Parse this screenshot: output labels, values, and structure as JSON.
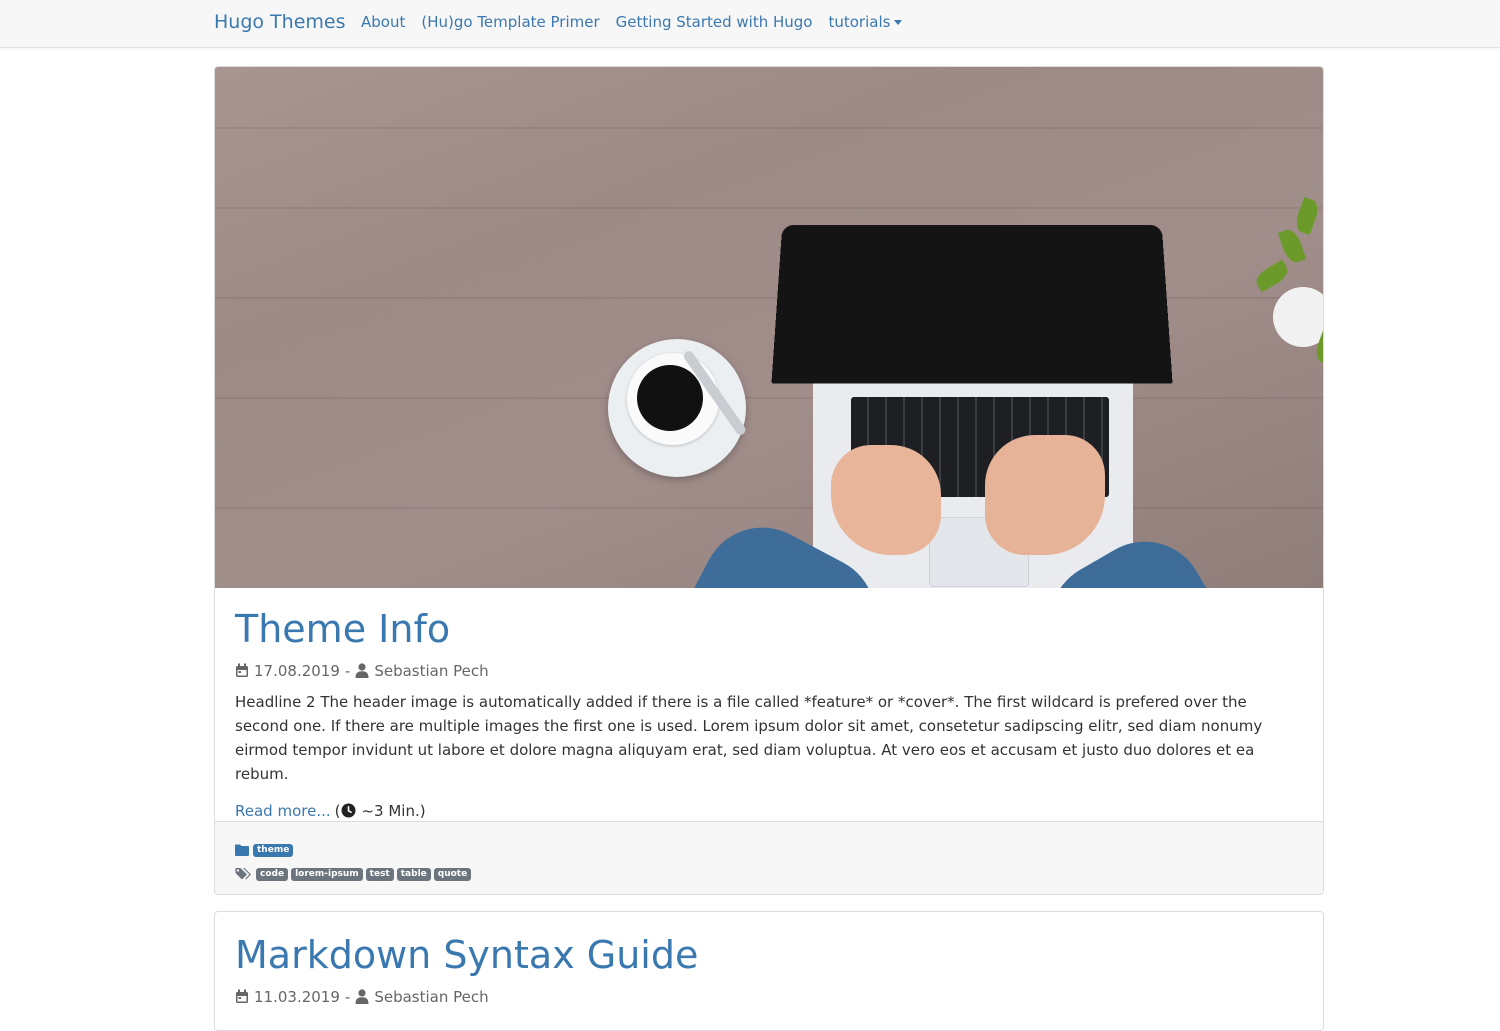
{
  "nav": {
    "brand": "Hugo Themes",
    "links": [
      "About",
      "(Hu)go Template Primer",
      "Getting Started with Hugo"
    ],
    "dropdown": "tutorials"
  },
  "posts": [
    {
      "title": "Theme Info",
      "date": "17.08.2019",
      "author": "Sebastian Pech",
      "summary": "Headline 2 The header image is automatically added if there is a file called *feature* or *cover*. The first wildcard is prefered over the second one. If there are multiple images the first one is used. Lorem ipsum dolor sit amet, consetetur sadipscing elitr, sed diam nonumy eirmod tempor invidunt ut labore et dolore magna aliquyam erat, sed diam voluptua. At vero eos et accusam et justo duo dolores et ea rebum.",
      "read_more": "Read more...",
      "reading_time": "~3 Min.)",
      "reading_open": "(",
      "category": "theme",
      "tags": [
        "code",
        "lorem-ipsum",
        "test",
        "table",
        "quote"
      ]
    },
    {
      "title": "Markdown Syntax Guide",
      "date": "11.03.2019",
      "author": "Sebastian Pech"
    }
  ],
  "colors": {
    "link": "#3a78b0",
    "navbar_bg": "#f7f7f7",
    "badge_category": "#3a78b0",
    "badge_tag": "#6c757d"
  },
  "icons": [
    "calendar-icon",
    "user-icon",
    "clock-icon",
    "folder-icon",
    "tags-icon",
    "caret-down-icon"
  ]
}
